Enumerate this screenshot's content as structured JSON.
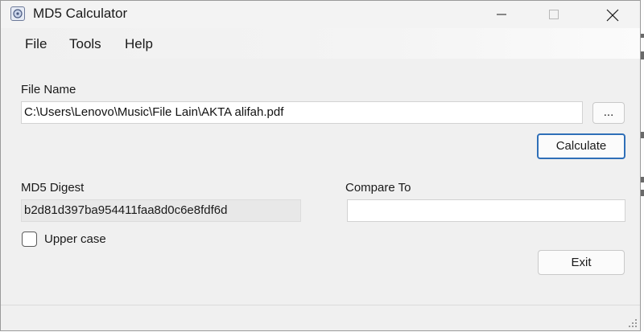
{
  "window": {
    "title": "MD5 Calculator",
    "icon": "app-icon"
  },
  "menu": {
    "items": [
      "File",
      "Tools",
      "Help"
    ]
  },
  "file_name": {
    "label": "File Name",
    "value": "C:\\Users\\Lenovo\\Music\\File Lain\\AKTA alifah.pdf",
    "browse_label": "..."
  },
  "calculate_label": "Calculate",
  "digest": {
    "label": "MD5 Digest",
    "value": "b2d81d397ba954411faa8d0c6e8fdf6d"
  },
  "compare": {
    "label": "Compare To",
    "value": ""
  },
  "uppercase": {
    "label": "Upper case",
    "checked": false
  },
  "exit_label": "Exit",
  "colors": {
    "default_button_border": "#2f6fb8",
    "window_bg": "#f0f0f0"
  }
}
